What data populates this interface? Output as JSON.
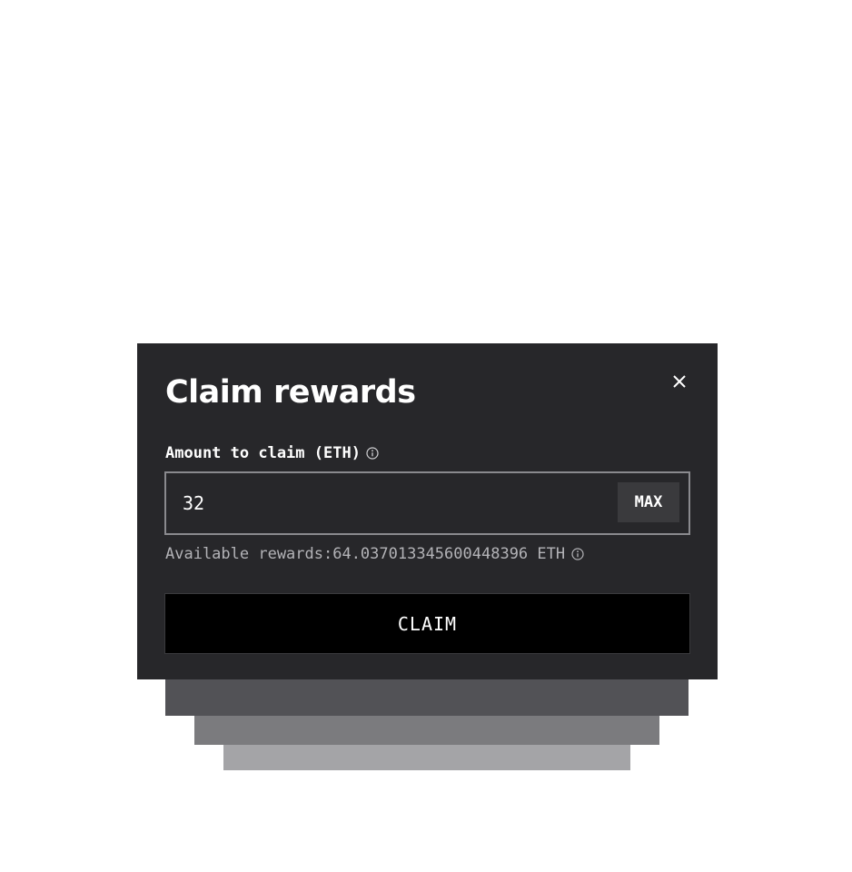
{
  "modal": {
    "title": "Claim rewards",
    "close_icon": "close-icon",
    "amount_label": "Amount to claim (ETH)",
    "amount_info_icon": "info-icon",
    "amount_value": "32",
    "max_label": "MAX",
    "available_text": "Available rewards:64.037013345600448396 ETH",
    "available_info_icon": "info-icon",
    "claim_label": "CLAIM"
  },
  "colors": {
    "modal_bg": "#27272a",
    "stack_1": "#525256",
    "stack_2": "#7b7b7e",
    "stack_3": "#a4a4a7",
    "claim_bg": "#000000",
    "input_border": "#8a8a8e",
    "max_bg": "#3a3a3d"
  }
}
